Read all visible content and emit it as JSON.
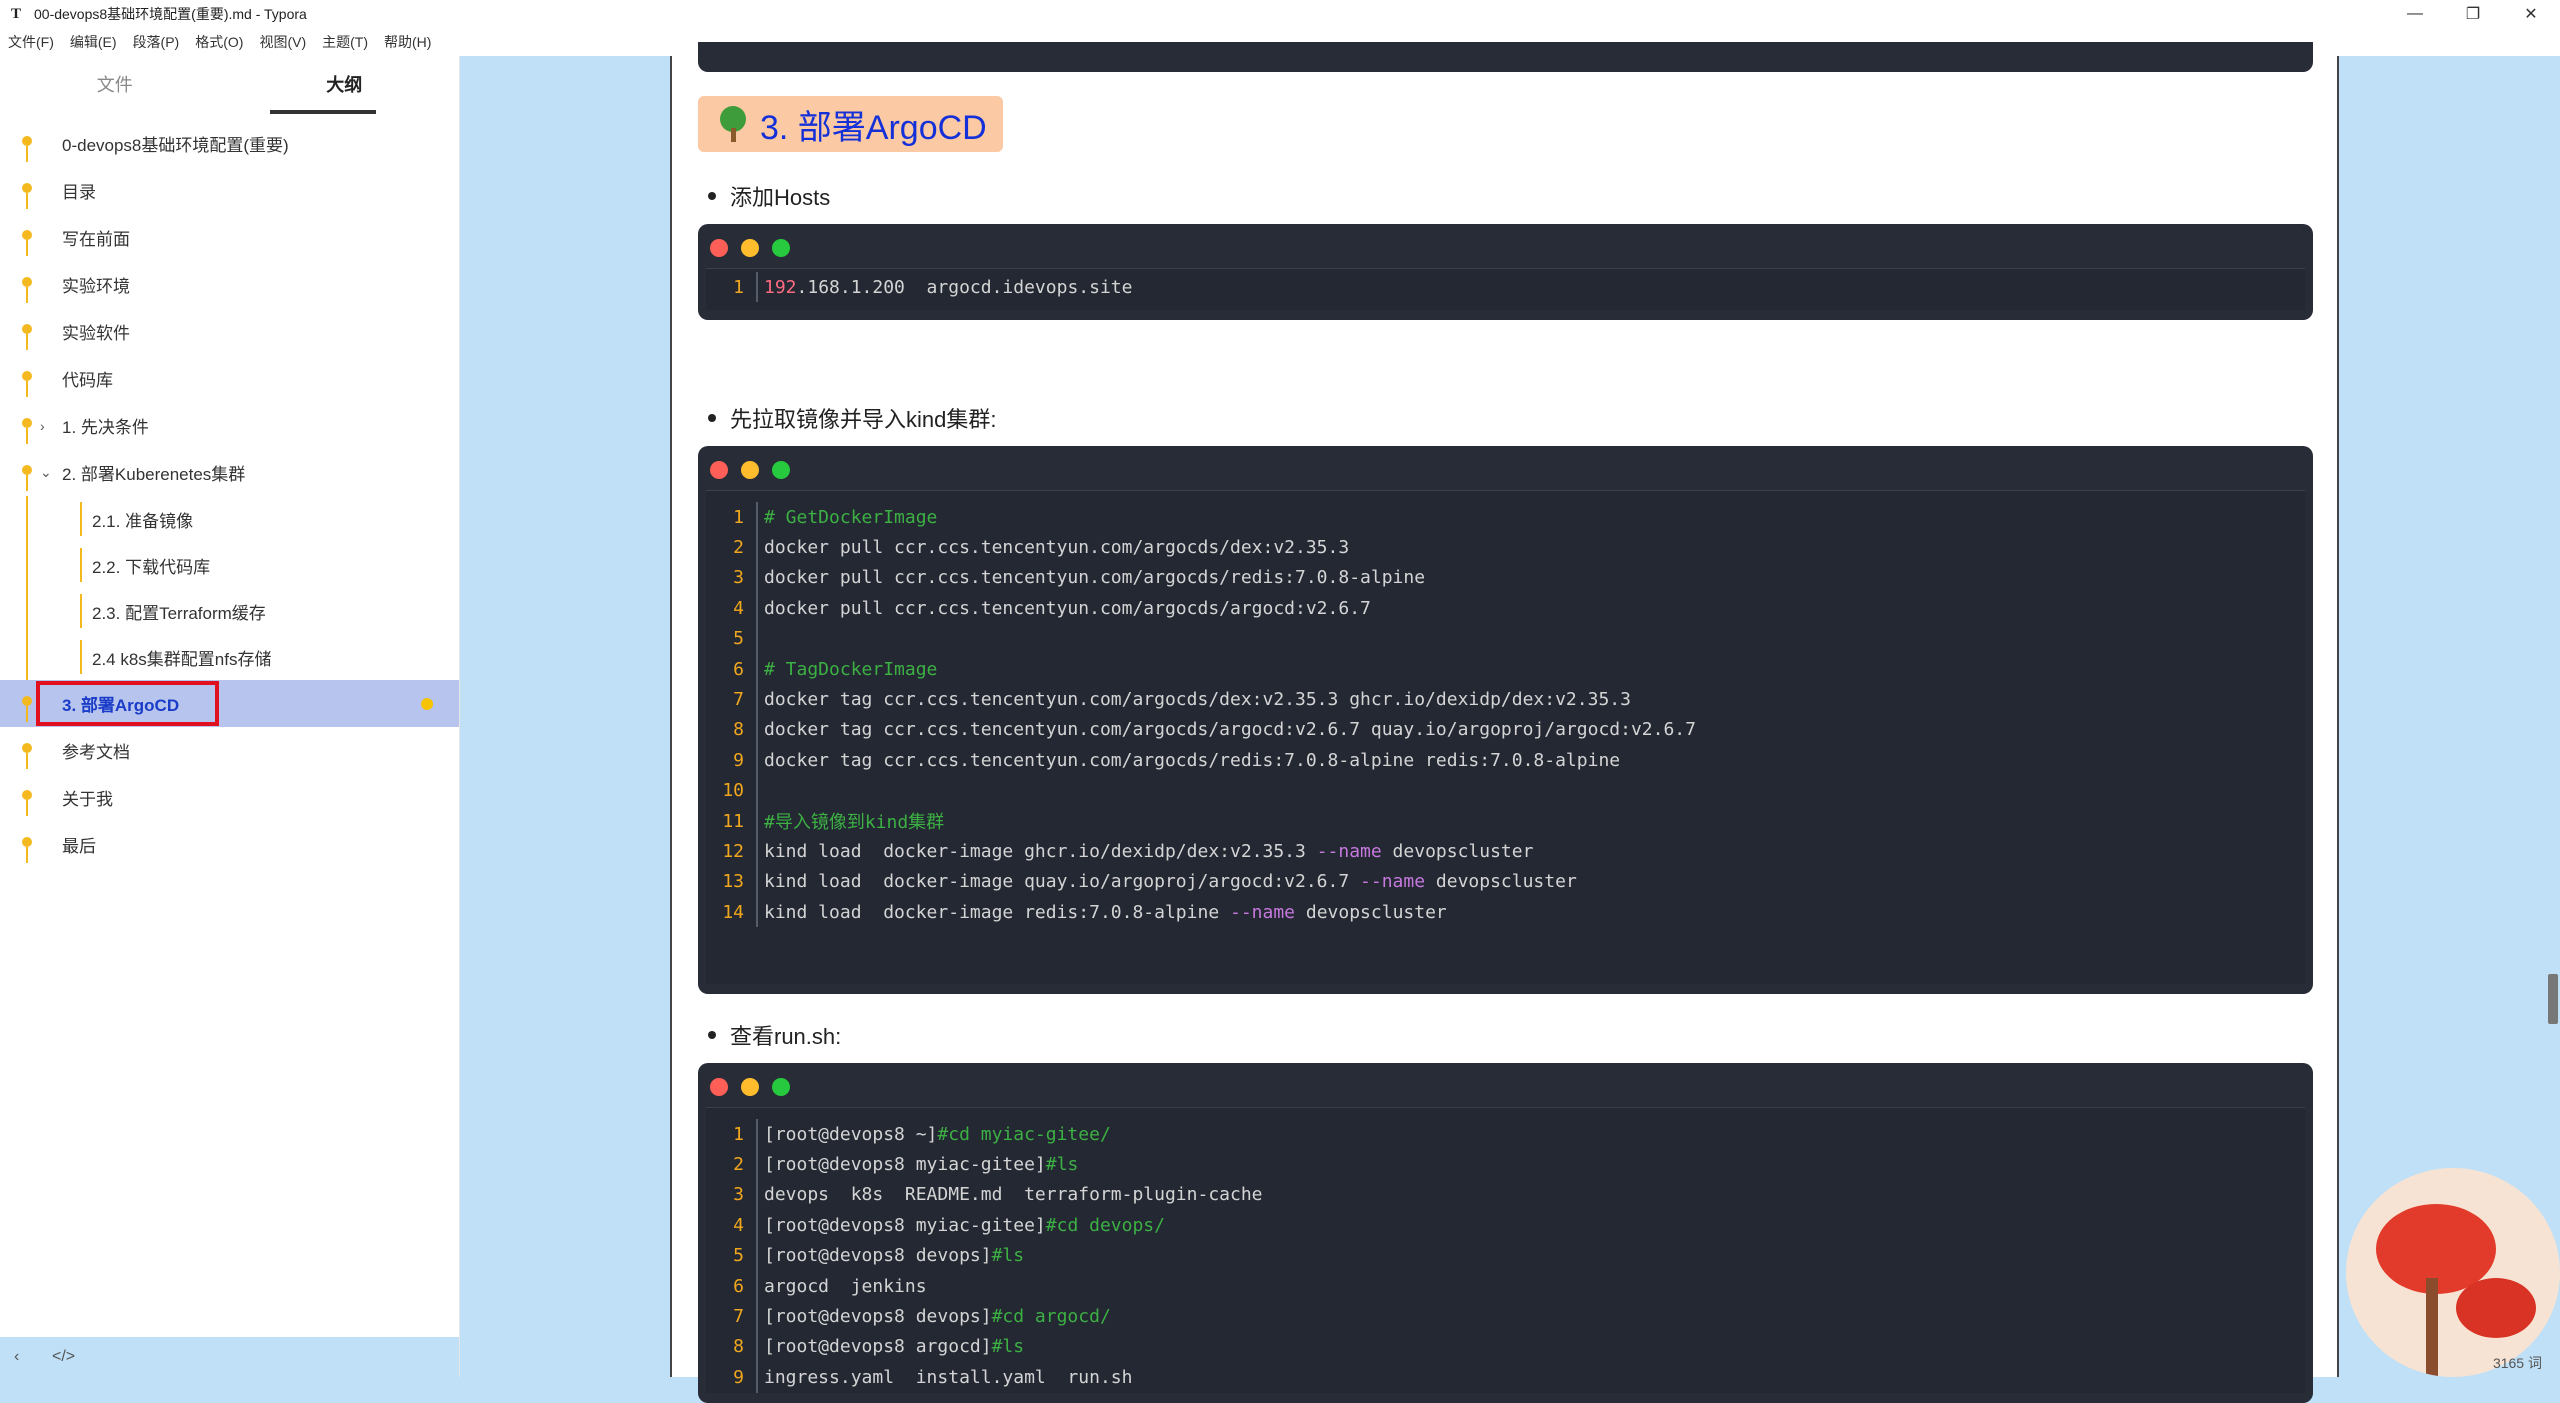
{
  "window": {
    "title": "00-devops8基础环境配置(重要).md - Typora",
    "app_icon": "T"
  },
  "menu": [
    "文件(F)",
    "编辑(E)",
    "段落(P)",
    "格式(O)",
    "视图(V)",
    "主题(T)",
    "帮助(H)"
  ],
  "sidebar": {
    "tabs": [
      "文件",
      "大纲"
    ],
    "active_tab": "大纲",
    "outline": [
      {
        "label": "0-devops8基础环境配置(重要)",
        "level": 1
      },
      {
        "label": "目录",
        "level": 1
      },
      {
        "label": "写在前面",
        "level": 1
      },
      {
        "label": "实验环境",
        "level": 1
      },
      {
        "label": "实验软件",
        "level": 1
      },
      {
        "label": "代码库",
        "level": 1
      },
      {
        "label": "1. 先决条件",
        "level": 1,
        "caret": "›"
      },
      {
        "label": "2. 部署Kuberenetes集群",
        "level": 1,
        "caret": "⌄"
      },
      {
        "label": "2.1. 准备镜像",
        "level": 2
      },
      {
        "label": "2.2. 下载代码库",
        "level": 2
      },
      {
        "label": "2.3. 配置Terraform缓存",
        "level": 2
      },
      {
        "label": "2.4 k8s集群配置nfs存储",
        "level": 2
      },
      {
        "label": "3. 部署ArgoCD",
        "level": 1,
        "active": true
      },
      {
        "label": "参考文档",
        "level": 1
      },
      {
        "label": "关于我",
        "level": 1
      },
      {
        "label": "最后",
        "level": 1
      }
    ],
    "footer": [
      "‹",
      "</>"
    ]
  },
  "editor": {
    "heading": "3. 部署ArgoCD",
    "bullets": [
      "添加Hosts",
      "先拉取镜像并导入kind集群:",
      "查看run.sh:"
    ],
    "code_hosts": [
      [
        {
          "t": "192",
          "c": "num"
        },
        {
          "t": ".168.1.200  argocd.idevops.site",
          "c": ""
        }
      ]
    ],
    "code_images": [
      [
        {
          "t": "# GetDockerImage",
          "c": "comment"
        }
      ],
      [
        {
          "t": "docker pull ccr.ccs.tencentyun.com/argocds/dex:v2.35.3",
          "c": ""
        }
      ],
      [
        {
          "t": "docker pull ccr.ccs.tencentyun.com/argocds/redis:7.0.8-alpine",
          "c": ""
        }
      ],
      [
        {
          "t": "docker pull ccr.ccs.tencentyun.com/argocds/argocd:v2.6.7",
          "c": ""
        }
      ],
      [],
      [
        {
          "t": "# TagDockerImage",
          "c": "comment"
        }
      ],
      [
        {
          "t": "docker tag ccr.ccs.tencentyun.com/argocds/dex:v2.35.3 ghcr.io/dexidp/dex:v2.35.3",
          "c": ""
        }
      ],
      [
        {
          "t": "docker tag ccr.ccs.tencentyun.com/argocds/argocd:v2.6.7 quay.io/argoproj/argocd:v2.6.7",
          "c": ""
        }
      ],
      [
        {
          "t": "docker tag ccr.ccs.tencentyun.com/argocds/redis:7.0.8-alpine redis:7.0.8-alpine",
          "c": ""
        }
      ],
      [],
      [
        {
          "t": "#导入镜像到kind集群",
          "c": "comment"
        }
      ],
      [
        {
          "t": "kind load  docker-image ghcr.io/dexidp/dex:v2.35.3 ",
          "c": ""
        },
        {
          "t": "--name",
          "c": "opt"
        },
        {
          "t": " devopscluster",
          "c": ""
        }
      ],
      [
        {
          "t": "kind load  docker-image quay.io/argoproj/argocd:v2.6.7 ",
          "c": ""
        },
        {
          "t": "--name",
          "c": "opt"
        },
        {
          "t": " devopscluster",
          "c": ""
        }
      ],
      [
        {
          "t": "kind load  docker-image redis:7.0.8-alpine ",
          "c": ""
        },
        {
          "t": "--name",
          "c": "opt"
        },
        {
          "t": " devopscluster",
          "c": ""
        }
      ]
    ],
    "code_run": [
      [
        {
          "t": "[root@devops8 ~]",
          "c": ""
        },
        {
          "t": "#cd myiac-gitee/",
          "c": "comment"
        }
      ],
      [
        {
          "t": "[root@devops8 myiac-gitee]",
          "c": ""
        },
        {
          "t": "#ls",
          "c": "comment"
        }
      ],
      [
        {
          "t": "devops  k8s  README.md  terraform-plugin-cache",
          "c": ""
        }
      ],
      [
        {
          "t": "[root@devops8 myiac-gitee]",
          "c": ""
        },
        {
          "t": "#cd devops/",
          "c": "comment"
        }
      ],
      [
        {
          "t": "[root@devops8 devops]",
          "c": ""
        },
        {
          "t": "#ls",
          "c": "comment"
        }
      ],
      [
        {
          "t": "argocd  jenkins",
          "c": ""
        }
      ],
      [
        {
          "t": "[root@devops8 devops]",
          "c": ""
        },
        {
          "t": "#cd argocd/",
          "c": "comment"
        }
      ],
      [
        {
          "t": "[root@devops8 argocd]",
          "c": ""
        },
        {
          "t": "#ls",
          "c": "comment"
        }
      ],
      [
        {
          "t": "ingress.yaml  install.yaml  run.sh",
          "c": ""
        }
      ]
    ],
    "word_count": "3165 词"
  },
  "colors": {
    "accent_outline": "#f5b920",
    "active_row": "#b7c4ee",
    "highlight_box": "#e0101e",
    "heading_bg": "#fbc9a3",
    "heading_text": "#1431d9",
    "code_bg": "#272c36",
    "traffic_lights": [
      "#ff5f56",
      "#ffbd2e",
      "#27c93f"
    ]
  },
  "icons": {
    "minimize": "minimize-icon",
    "maximize": "restore-icon",
    "close": "close-icon",
    "heading": "tree-emoji-icon"
  }
}
